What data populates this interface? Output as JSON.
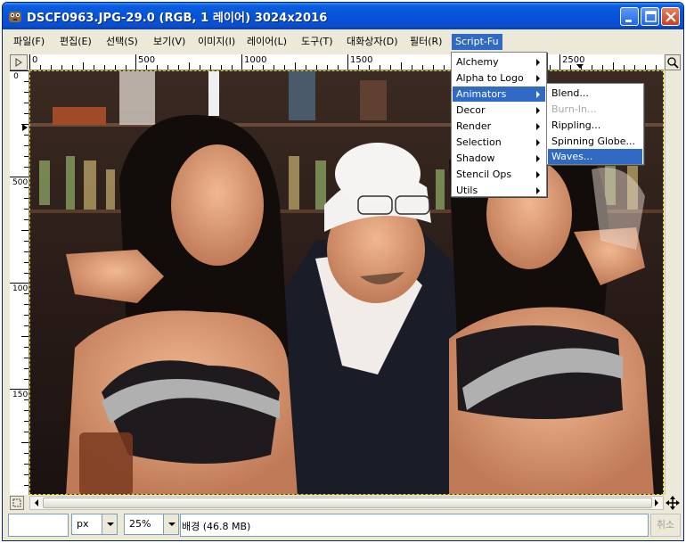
{
  "window": {
    "title": "DSCF0963.JPG-29.0 (RGB, 1 레이어) 3024x2016",
    "controls": [
      "minimize",
      "maximize",
      "close"
    ]
  },
  "menubar": {
    "items": [
      {
        "label": "파일(F)"
      },
      {
        "label": "편집(E)"
      },
      {
        "label": "선택(S)"
      },
      {
        "label": "보기(V)"
      },
      {
        "label": "이미지(I)"
      },
      {
        "label": "레이어(L)"
      },
      {
        "label": "도구(T)"
      },
      {
        "label": "대화상자(D)"
      },
      {
        "label": "필터(R)"
      },
      {
        "label": "Script-Fu"
      }
    ]
  },
  "scriptfu_menu": {
    "items": [
      {
        "label": "Alchemy"
      },
      {
        "label": "Alpha to Logo"
      },
      {
        "label": "Animators"
      },
      {
        "label": "Decor"
      },
      {
        "label": "Render"
      },
      {
        "label": "Selection"
      },
      {
        "label": "Shadow"
      },
      {
        "label": "Stencil Ops"
      },
      {
        "label": "Utils"
      }
    ]
  },
  "animators_menu": {
    "items": [
      {
        "label": "Blend..."
      },
      {
        "label": "Burn-In..."
      },
      {
        "label": "Rippling..."
      },
      {
        "label": "Spinning Globe..."
      },
      {
        "label": "Waves..."
      }
    ]
  },
  "rulers": {
    "horizontal": [
      "0",
      "500",
      "1000",
      "1500",
      "2000",
      "2500"
    ],
    "vertical": [
      "0",
      "500",
      "1000",
      "1500"
    ]
  },
  "statusbar": {
    "unit": "px",
    "zoom": "25%",
    "info": "배경  (46.8 MB)",
    "cancel": "취소"
  },
  "colors": {
    "title_bar": "#0a5ee0",
    "selection": "#316ac5",
    "window_bg": "#ece9d8"
  }
}
